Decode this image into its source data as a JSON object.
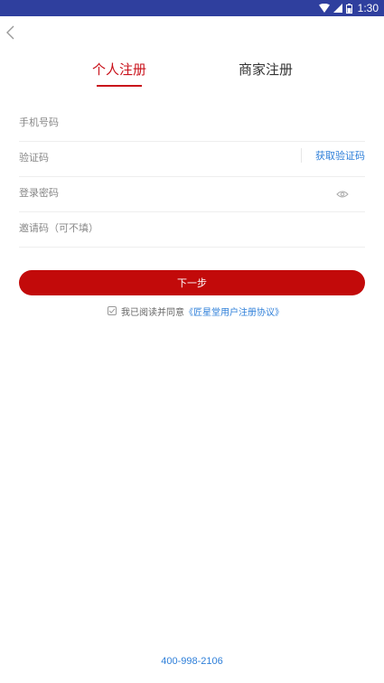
{
  "status_bar": {
    "time": "1:30"
  },
  "tabs": {
    "personal": "个人注册",
    "merchant": "商家注册"
  },
  "form": {
    "phone_placeholder": "手机号码",
    "code_placeholder": "验证码",
    "get_code": "获取验证码",
    "password_placeholder": "登录密码",
    "invite_placeholder": "邀请码（可不填）"
  },
  "next_button": "下一步",
  "agreement": {
    "text": "我已阅读并同意",
    "link": "《匠星堂用户注册协议》",
    "checked": true
  },
  "footer": {
    "phone": "400-998-2106"
  },
  "colors": {
    "accent_red": "#c9121b",
    "button_red": "#c20a0a",
    "link_blue": "#2e7fd9",
    "status_bar": "#2f3f9e"
  }
}
